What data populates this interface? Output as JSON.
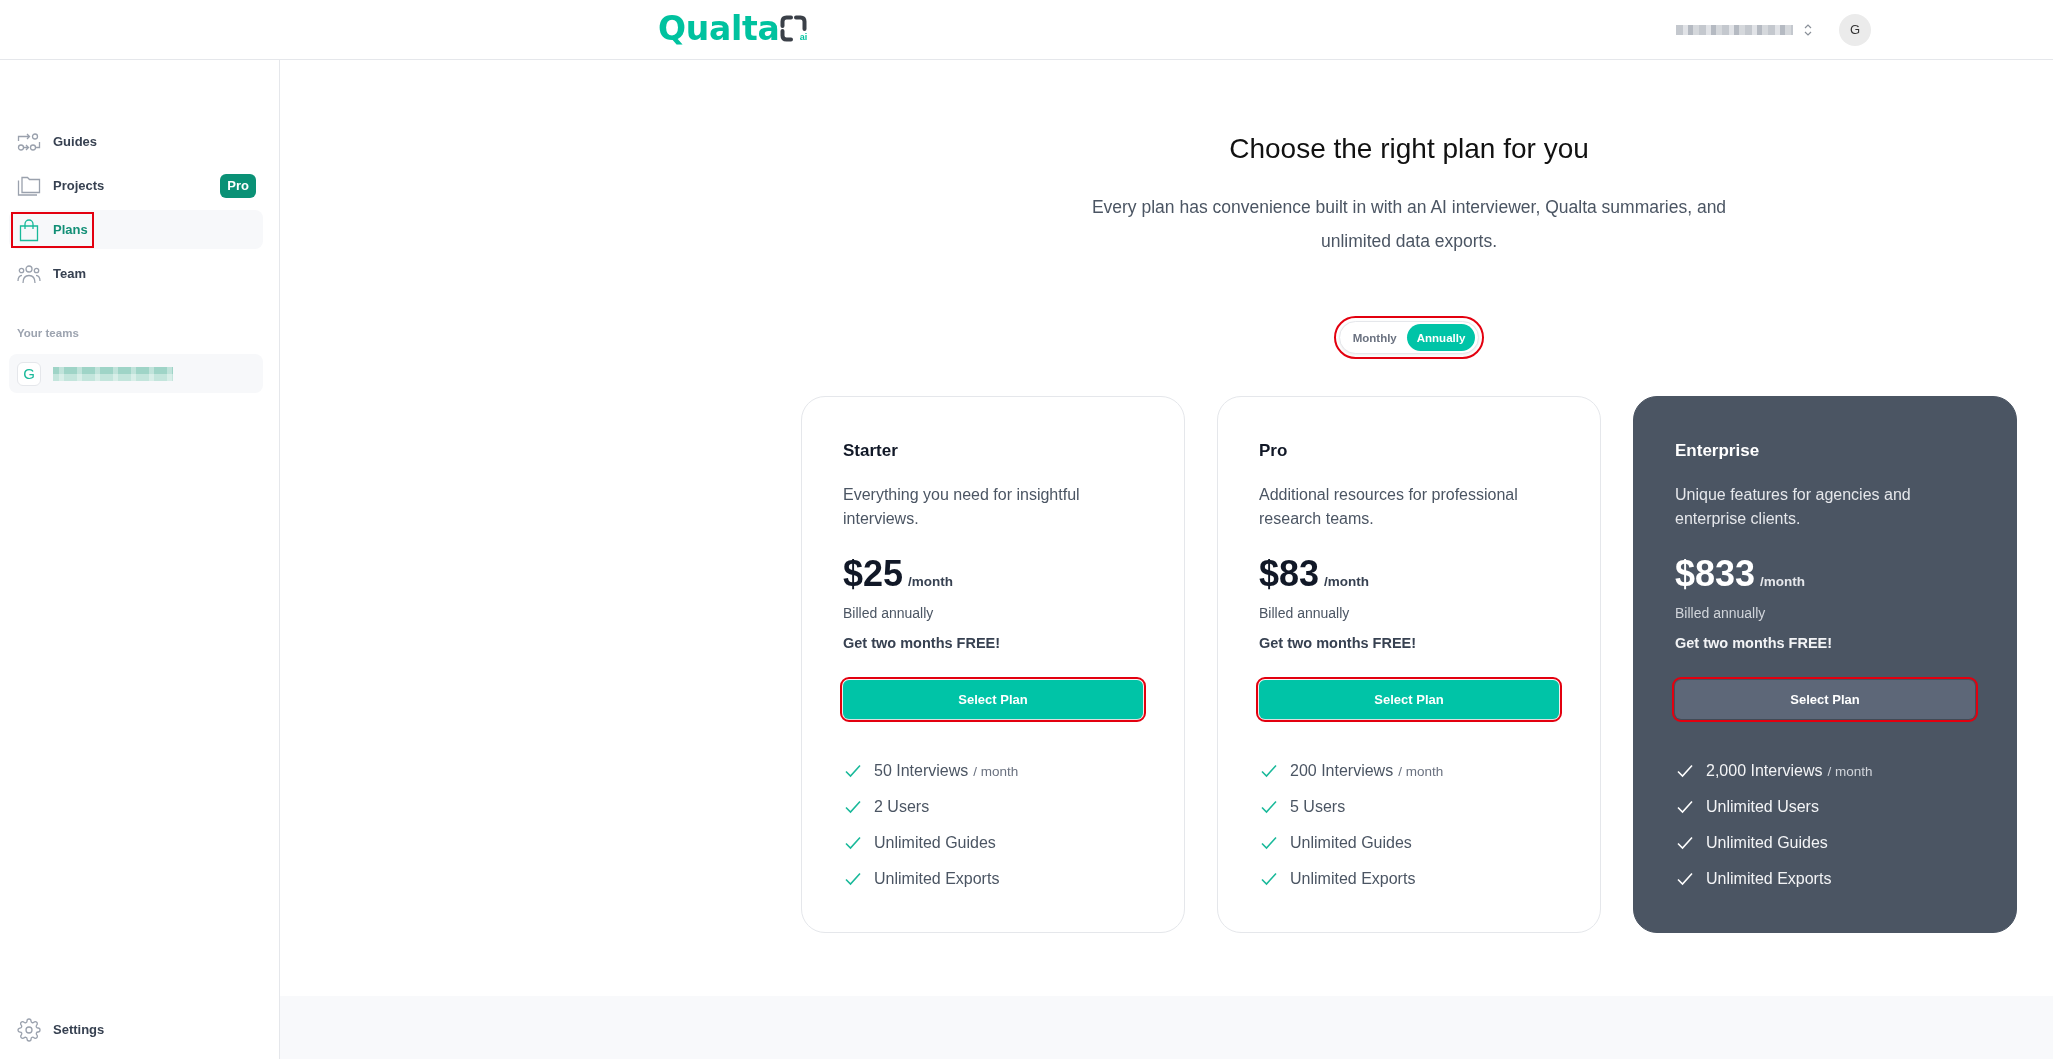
{
  "header": {
    "logo": {
      "text": "Qualta",
      "suffix": "ai"
    },
    "avatar": {
      "initial": "G"
    }
  },
  "sidebar": {
    "items": [
      {
        "label": "Guides",
        "selected": false,
        "highlighted": false
      },
      {
        "label": "Projects",
        "badge": "Pro",
        "selected": false,
        "highlighted": false
      },
      {
        "label": "Plans",
        "selected": true,
        "highlighted": true
      },
      {
        "label": "Team",
        "selected": false,
        "highlighted": false
      }
    ],
    "teams_heading": "Your teams",
    "teams": [
      {
        "initial": "G"
      }
    ],
    "settings": {
      "label": "Settings"
    }
  },
  "main": {
    "title": "Choose the right plan for you",
    "subtitle": "Every plan has convenience built in with an AI interviewer, Qualta summaries, and unlimited data exports.",
    "billing_toggle": {
      "highlighted": true,
      "options": [
        {
          "label": "Monthly",
          "selected": false
        },
        {
          "label": "Annually",
          "selected": true
        }
      ]
    },
    "plans": [
      {
        "kind": "standard",
        "name": "Starter",
        "description": "Everything you need for insightful interviews.",
        "price": "$25",
        "period": "/month",
        "billing_note": "Billed annually",
        "promo": "Get two months FREE!",
        "button": {
          "label": "Select Plan",
          "highlighted": true
        },
        "features": [
          {
            "text": "50 Interviews",
            "unit": "/ month"
          },
          {
            "text": "2 Users"
          },
          {
            "text": "Unlimited Guides"
          },
          {
            "text": "Unlimited Exports"
          }
        ]
      },
      {
        "kind": "standard",
        "name": "Pro",
        "description": "Additional resources for professional research teams.",
        "price": "$83",
        "period": "/month",
        "billing_note": "Billed annually",
        "promo": "Get two months FREE!",
        "button": {
          "label": "Select Plan",
          "highlighted": true
        },
        "features": [
          {
            "text": "200 Interviews",
            "unit": "/ month"
          },
          {
            "text": "5 Users"
          },
          {
            "text": "Unlimited Guides"
          },
          {
            "text": "Unlimited Exports"
          }
        ]
      },
      {
        "kind": "inverted",
        "name": "Enterprise",
        "description": "Unique features for agencies and enterprise clients.",
        "price": "$833",
        "period": "/month",
        "billing_note": "Billed annually",
        "promo": "Get two months FREE!",
        "button": {
          "label": "Select Plan",
          "highlighted": true
        },
        "features": [
          {
            "text": "2,000 Interviews",
            "unit": "/ month"
          },
          {
            "text": "Unlimited Users"
          },
          {
            "text": "Unlimited Guides"
          },
          {
            "text": "Unlimited Exports"
          }
        ]
      }
    ]
  }
}
